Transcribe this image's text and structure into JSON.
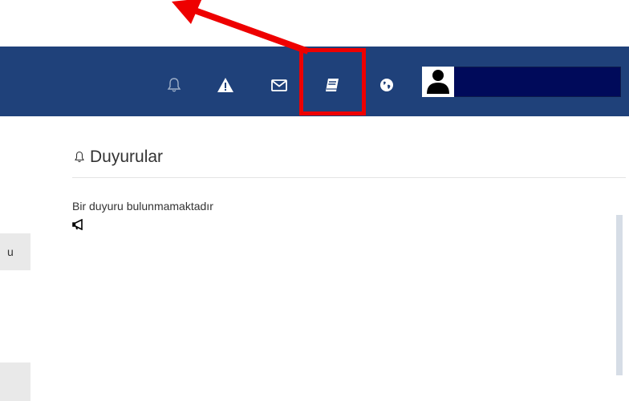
{
  "header": {
    "nav_icons": [
      {
        "name": "bell-icon",
        "color": "#9fb0c8"
      },
      {
        "name": "warning-icon",
        "color": "#ffffff"
      },
      {
        "name": "mail-icon",
        "color": "#ffffff"
      },
      {
        "name": "book-icon",
        "color": "#ffffff"
      },
      {
        "name": "globe-icon",
        "color": "#ffffff"
      }
    ],
    "user_name": "",
    "bar_color": "#1f417a"
  },
  "annotation": {
    "highlight_color": "#ee0000",
    "target": "book-icon"
  },
  "announcements": {
    "title": "Duyurular",
    "empty_message": "Bir duyuru bulunmamaktadır"
  },
  "side_panel": {
    "tab_label": "u"
  }
}
